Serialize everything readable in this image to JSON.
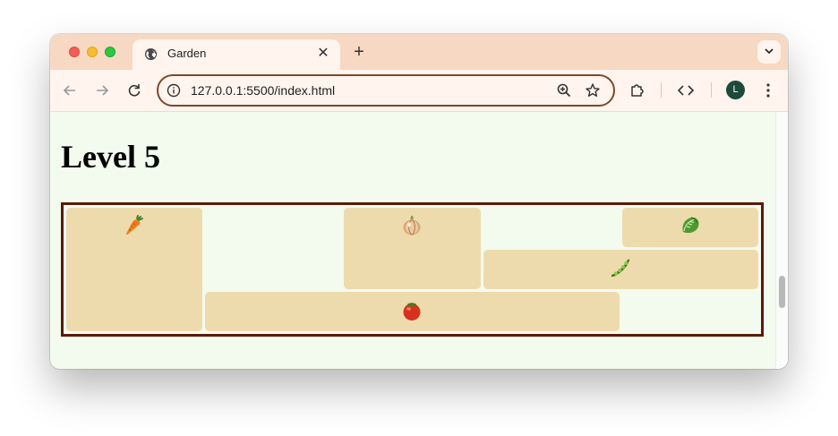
{
  "browser": {
    "tab_title": "Garden",
    "new_tab_label": "+",
    "tab_close_label": "✕",
    "url": "127.0.0.1:5500/index.html",
    "profile_initial": "L"
  },
  "page": {
    "heading": "Level 5"
  },
  "garden": {
    "plots": [
      {
        "name": "carrot-plot",
        "vegetable": "carrot-icon"
      },
      {
        "name": "onion-plot",
        "vegetable": "onion-icon"
      },
      {
        "name": "lettuce-plot",
        "vegetable": "lettuce-icon"
      },
      {
        "name": "pea-plot",
        "vegetable": "pea-pod-icon"
      },
      {
        "name": "tomato-plot",
        "vegetable": "tomato-icon"
      }
    ]
  },
  "colors": {
    "frame": "#f7d8c2",
    "toolbar": "#fff4ee",
    "page_background": "#f2fbee",
    "plot": "#eedbad",
    "garden_border": "#5a1a0a",
    "avatar": "#1d4a3a"
  }
}
